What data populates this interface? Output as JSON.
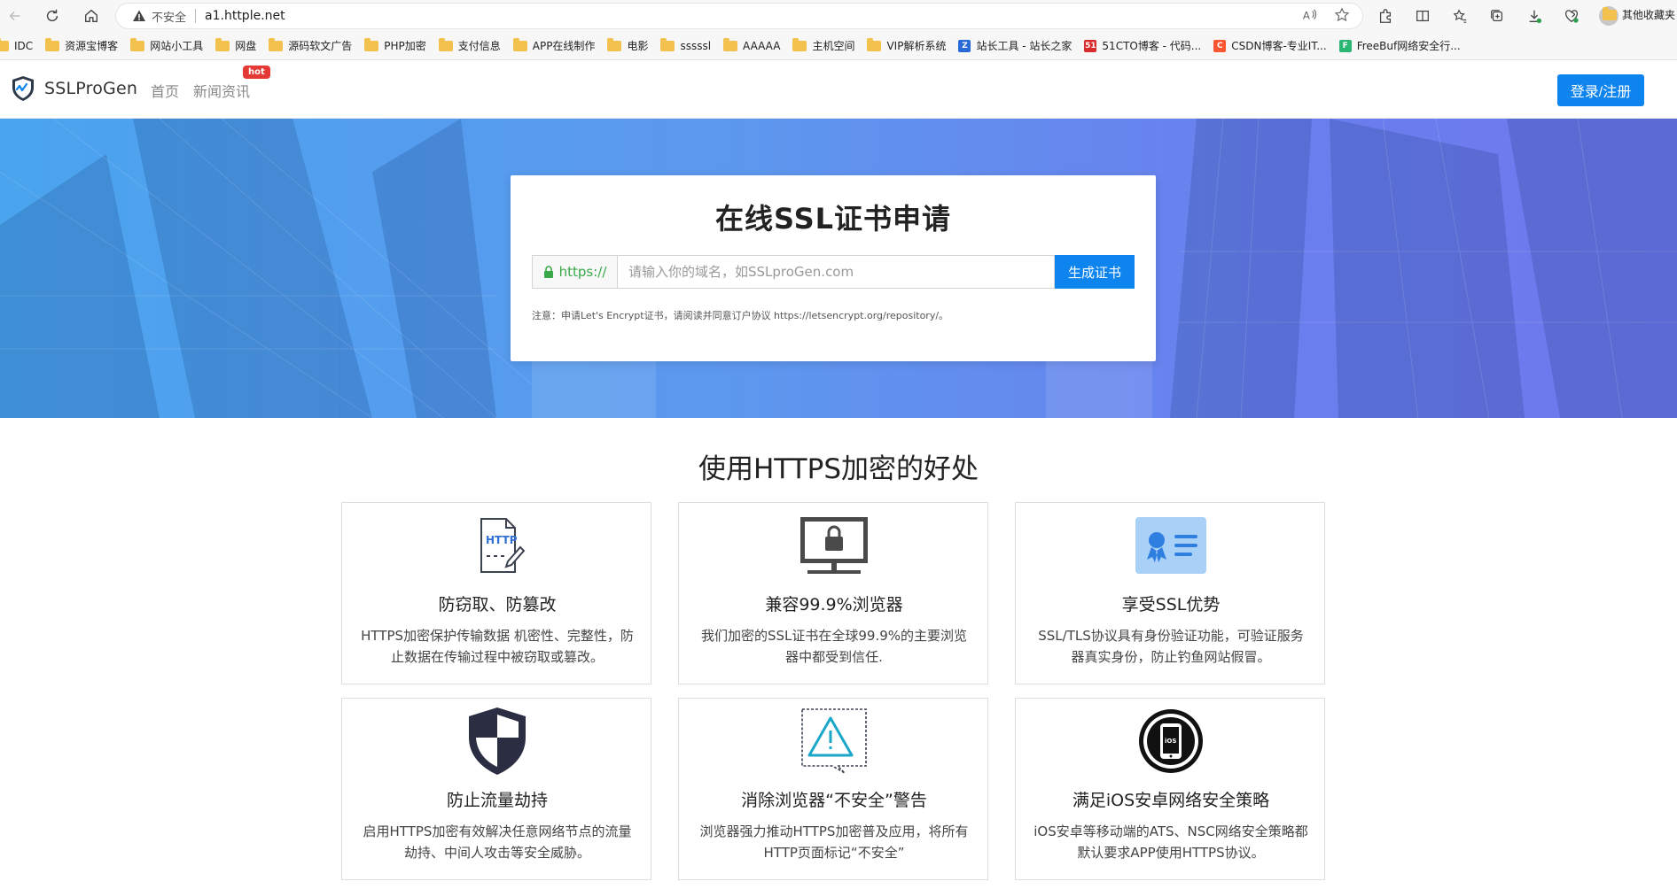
{
  "browser": {
    "insecure_label": "不安全",
    "url": "a1.httple.net"
  },
  "bookmarks": {
    "items": [
      {
        "label": "IDC",
        "type": "folder"
      },
      {
        "label": "资源宝博客",
        "type": "folder"
      },
      {
        "label": "网站小工具",
        "type": "folder"
      },
      {
        "label": "网盘",
        "type": "folder"
      },
      {
        "label": "源码软文广告",
        "type": "folder"
      },
      {
        "label": "PHP加密",
        "type": "folder"
      },
      {
        "label": "支付信息",
        "type": "folder"
      },
      {
        "label": "APP在线制作",
        "type": "folder"
      },
      {
        "label": "电影",
        "type": "folder"
      },
      {
        "label": "sssssl",
        "type": "folder"
      },
      {
        "label": "AAAAA",
        "type": "folder"
      },
      {
        "label": "主机空间",
        "type": "folder"
      },
      {
        "label": "VIP解析系统",
        "type": "folder"
      },
      {
        "label": "站长工具 - 站长之家",
        "type": "chinaz"
      },
      {
        "label": "51CTO博客 - 代码...",
        "type": "51cto"
      },
      {
        "label": "CSDN博客-专业IT...",
        "type": "csdn"
      },
      {
        "label": "FreeBuf网络安全行...",
        "type": "freebuf"
      }
    ],
    "other_label": "其他收藏夹"
  },
  "header": {
    "logo_text": "SSLProGen",
    "nav_home": "首页",
    "nav_news": "新闻资讯",
    "hot_badge": "hot",
    "login_label": "登录/注册"
  },
  "hero": {
    "title": "在线SSL证书申请",
    "prefix": "https://",
    "input_placeholder": "请输入你的域名，如SSLproGen.com",
    "input_value": "",
    "button_label": "生成证书",
    "note": "注意：申请Let's Encrypt证书，请阅读并同意订户协议 https://letsencrypt.org/repository/。"
  },
  "benefits": {
    "title": "使用HTTPS加密的好处",
    "cards": [
      {
        "icon": "http-document-icon",
        "title": "防窃取、防篡改",
        "desc": "HTTPS加密保护传输数据 机密性、完整性，防止数据在传输过程中被窃取或篡改。"
      },
      {
        "icon": "monitor-lock-icon",
        "title": "兼容99.9%浏览器",
        "desc": "我们加密的SSL证书在全球99.9%的主要浏览器中都受到信任."
      },
      {
        "icon": "certificate-icon",
        "title": "享受SSL优势",
        "desc": "SSL/TLS协议具有身份验证功能，可验证服务器真实身份，防止钓鱼网站假冒。"
      },
      {
        "icon": "shield-icon",
        "title": "防止流量劫持",
        "desc": "启用HTTPS加密有效解决任意网络节点的流量劫持、中间人攻击等安全威胁。"
      },
      {
        "icon": "warning-icon",
        "title": "消除浏览器“不安全”警告",
        "desc": "浏览器强力推动HTTPS加密普及应用，将所有HTTP页面标记“不安全”"
      },
      {
        "icon": "ios-phone-icon",
        "title": "满足iOS安卓网络安全策略",
        "desc": "iOS安卓等移动端的ATS、NSC网络安全策略都默认要求APP使用HTTPS协议。"
      }
    ]
  },
  "colors": {
    "primary": "#0d84ee",
    "hot": "#e53935",
    "https_green": "#3aa848"
  }
}
